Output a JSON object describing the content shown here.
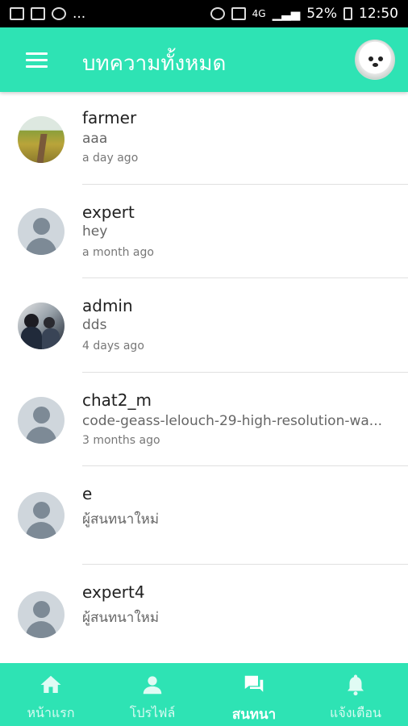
{
  "status_bar": {
    "ellipsis": "...",
    "network": "4G",
    "battery": "52%",
    "time": "12:50"
  },
  "app_bar": {
    "title": "บทความทั้งหมด",
    "menu_icon": "hamburger-icon",
    "avatar_icon": "profile-avatar"
  },
  "chats": [
    {
      "name": "farmer",
      "message": "aaa",
      "time": "a day ago",
      "avatar": "field-photo"
    },
    {
      "name": "expert",
      "message": "hey",
      "time": "a month ago",
      "avatar": "default-person"
    },
    {
      "name": "admin",
      "message": "dds",
      "time": "4 days ago",
      "avatar": "group-photo"
    },
    {
      "name": "chat2_m",
      "message": "code-geass-lelouch-29-high-resolution-wa...",
      "time": "3 months ago",
      "avatar": "default-person"
    },
    {
      "name": "e",
      "message": "ผู้สนทนาใหม่",
      "time": "",
      "avatar": "default-person"
    },
    {
      "name": "expert4",
      "message": "ผู้สนทนาใหม่",
      "time": "",
      "avatar": "default-person"
    }
  ],
  "bottom_nav": {
    "items": [
      {
        "label": "หน้าแรก",
        "icon": "home-icon",
        "active": false
      },
      {
        "label": "โปรไฟล์",
        "icon": "person-icon",
        "active": false
      },
      {
        "label": "สนทนา",
        "icon": "chat-icon",
        "active": true
      },
      {
        "label": "แจ้งเตือน",
        "icon": "bell-icon",
        "active": false
      }
    ]
  },
  "colors": {
    "primary": "#2ee3b4",
    "status_bar": "#000000",
    "divider": "#e0e0e0"
  }
}
